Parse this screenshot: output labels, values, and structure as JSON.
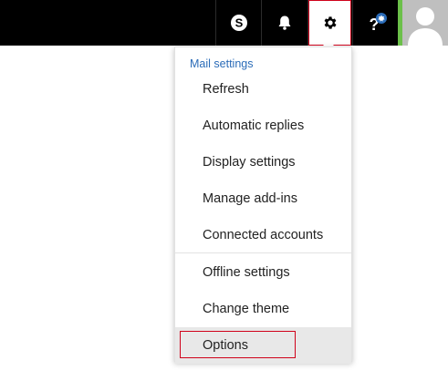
{
  "topbar": {
    "background": "#000000",
    "icons": {
      "skype": "skype-icon",
      "bell": "bell-icon",
      "gear": "gear-icon",
      "help": "help-icon"
    }
  },
  "menu": {
    "section_title": "Mail settings",
    "items": [
      {
        "label": "Refresh"
      },
      {
        "label": "Automatic replies"
      },
      {
        "label": "Display settings"
      },
      {
        "label": "Manage add-ins"
      },
      {
        "label": "Connected accounts"
      },
      {
        "label": "Offline settings"
      },
      {
        "label": "Change theme"
      },
      {
        "label": "Options"
      }
    ]
  },
  "colors": {
    "accent_link": "#2b6cb8",
    "highlight_border": "#d0021b",
    "avatar_presence": "#6cc04a"
  }
}
